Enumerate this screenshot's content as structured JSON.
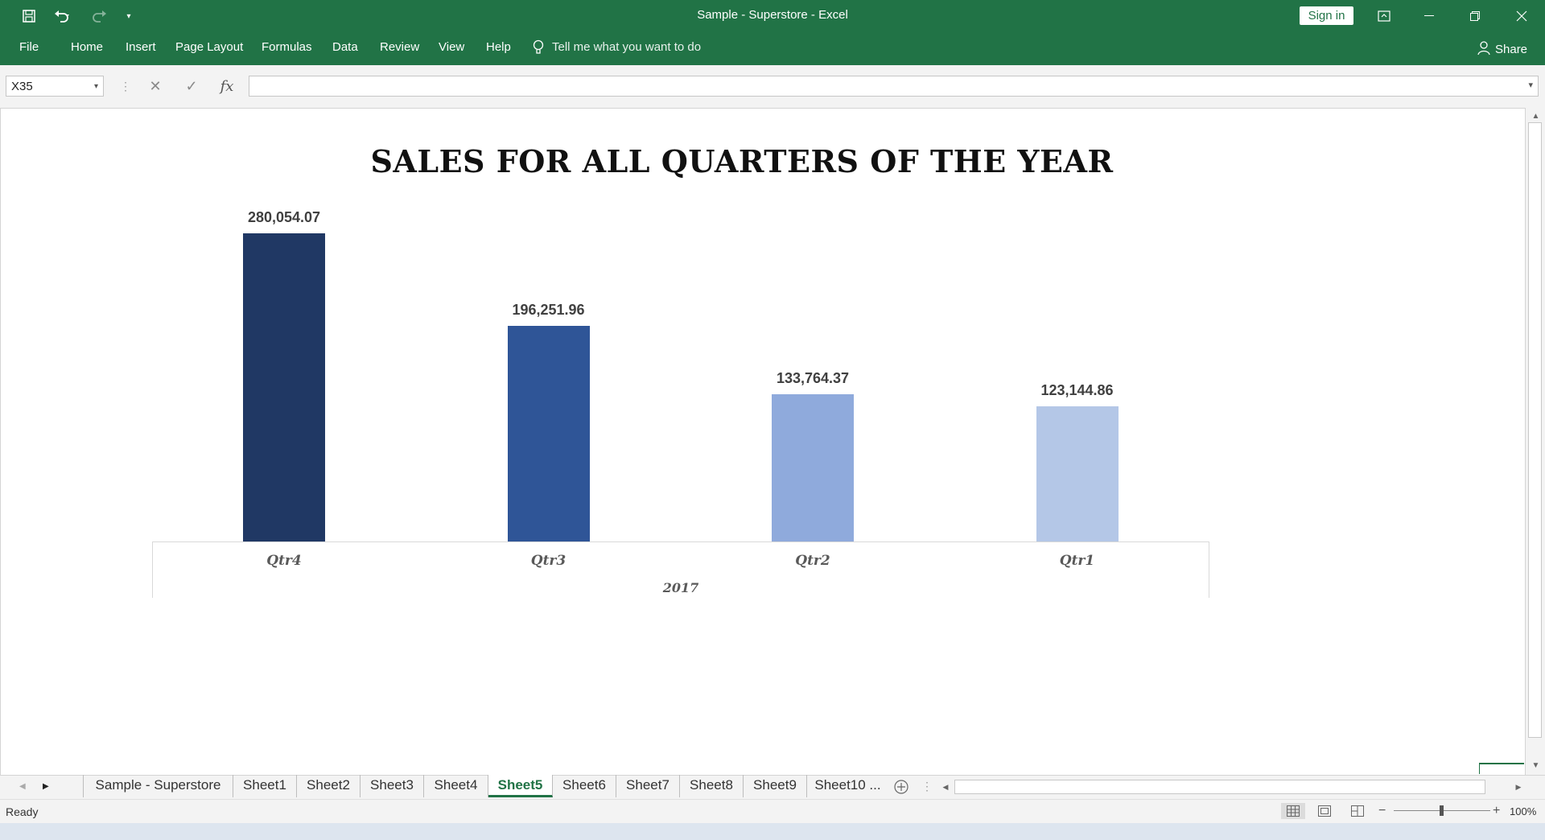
{
  "window": {
    "title": "Sample - Superstore  -  Excel",
    "sign_in_label": "Sign in",
    "share_label": "Share"
  },
  "ribbon": {
    "tabs": [
      "File",
      "Home",
      "Insert",
      "Page Layout",
      "Formulas",
      "Data",
      "Review",
      "View",
      "Help"
    ],
    "tell_me": "Tell me what you want to do"
  },
  "formula_bar": {
    "name_box": "X35",
    "fx": "fx",
    "content": ""
  },
  "chart_data": {
    "type": "bar",
    "title": "SALES FOR ALL QUARTERS OF THE YEAR",
    "categories": [
      "Qtr4",
      "Qtr3",
      "Qtr2",
      "Qtr1"
    ],
    "group_label": "2017",
    "values": [
      280054.07,
      196251.96,
      133764.37,
      123144.86
    ],
    "data_labels": [
      "280,054.07",
      "196,251.96",
      "133,764.37",
      "123,144.86"
    ],
    "colors": [
      "#203864",
      "#2f5597",
      "#8faadc",
      "#b4c7e7"
    ],
    "ylim": [
      0,
      280054.07
    ],
    "grid": false,
    "legend": "none"
  },
  "sheet_tabs": {
    "items": [
      "Sample - Superstore",
      "Sheet1",
      "Sheet2",
      "Sheet3",
      "Sheet4",
      "Sheet5",
      "Sheet6",
      "Sheet7",
      "Sheet8",
      "Sheet9",
      "Sheet10 ..."
    ],
    "active": "Sheet5"
  },
  "status_bar": {
    "status": "Ready",
    "zoom": "100%"
  },
  "colors": {
    "accent": "#217346"
  }
}
